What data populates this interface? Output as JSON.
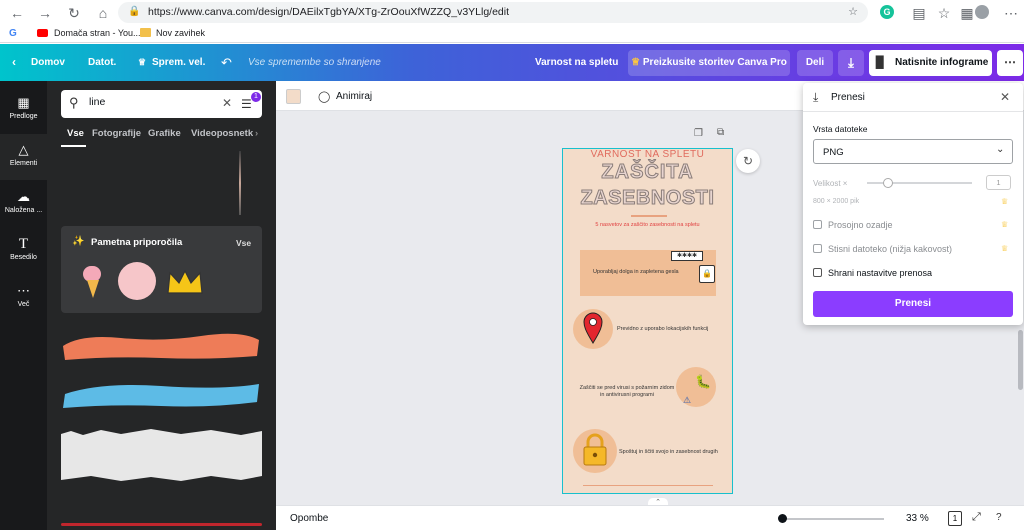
{
  "browser": {
    "url": "https://www.canva.com/design/DAEilxTgbYA/XTg-ZrOouXfWZZQ_v3YLlg/edit",
    "bookmarks": [
      {
        "label": "Domača stran - You...",
        "icon": "youtube-icon"
      },
      {
        "label": "Nov zavihek",
        "icon": "folder-icon"
      }
    ]
  },
  "topbar": {
    "home": "Domov",
    "file": "Datot.",
    "resize": "Sprem. vel.",
    "saved_status": "Vse spremembe so shranjene",
    "doc_title": "Varnost na spletu",
    "pro_button": "Preizkusite storitev Canva Pro",
    "share": "Deli",
    "print": "Natisnite infograme"
  },
  "rail": [
    {
      "label": "Predloge",
      "icon": "template-icon"
    },
    {
      "label": "Elementi",
      "icon": "elements-icon"
    },
    {
      "label": "Naložena ...",
      "icon": "upload-icon"
    },
    {
      "label": "Besedilo",
      "icon": "text-icon"
    },
    {
      "label": "Več",
      "icon": "more-icon"
    }
  ],
  "panel": {
    "search_value": "line",
    "filter_badge": "1",
    "tabs": [
      "Vse",
      "Fotografije",
      "Grafike",
      "Videoposnetki"
    ],
    "smart_title": "Pametna priporočila",
    "smart_all": "Vse"
  },
  "toolbar": {
    "animate": "Animiraj",
    "notes": "Opombe",
    "zoom": "33 %",
    "page_count": "1"
  },
  "design": {
    "header": "VARNOST NA SPLETU",
    "title1": "ZAŠČITA",
    "title2": "ZASEBNOSTI",
    "subtitle": "5 nasvetov za zaščito zasebnosti na spletu",
    "tip1": "Uporabljaj dolga in zapletena gesla",
    "tip2": "Previdno z uporabo lokacijskih funkcij",
    "tip3": "Zaščiti se pred virusi s požarnim zidom in antivirusni programi",
    "tip4": "Spoštuj in ščiti svojo in zasebnost drugih"
  },
  "download": {
    "title": "Prenesi",
    "file_type_label": "Vrsta datoteke",
    "file_type": "PNG",
    "size_label": "Velikost ×",
    "size_value": "1",
    "dimensions": "800 × 2000 pik",
    "transparent": "Prosojno ozadje",
    "compress": "Stisni datoteko (nižja kakovost)",
    "save_settings": "Shrani nastavitve prenosa",
    "button": "Prenesi"
  },
  "colors": {
    "accent": "#7d2ae8",
    "download_button": "#8b3dff",
    "page_bg": "#f3dcc9",
    "title": "#e06b5e"
  }
}
